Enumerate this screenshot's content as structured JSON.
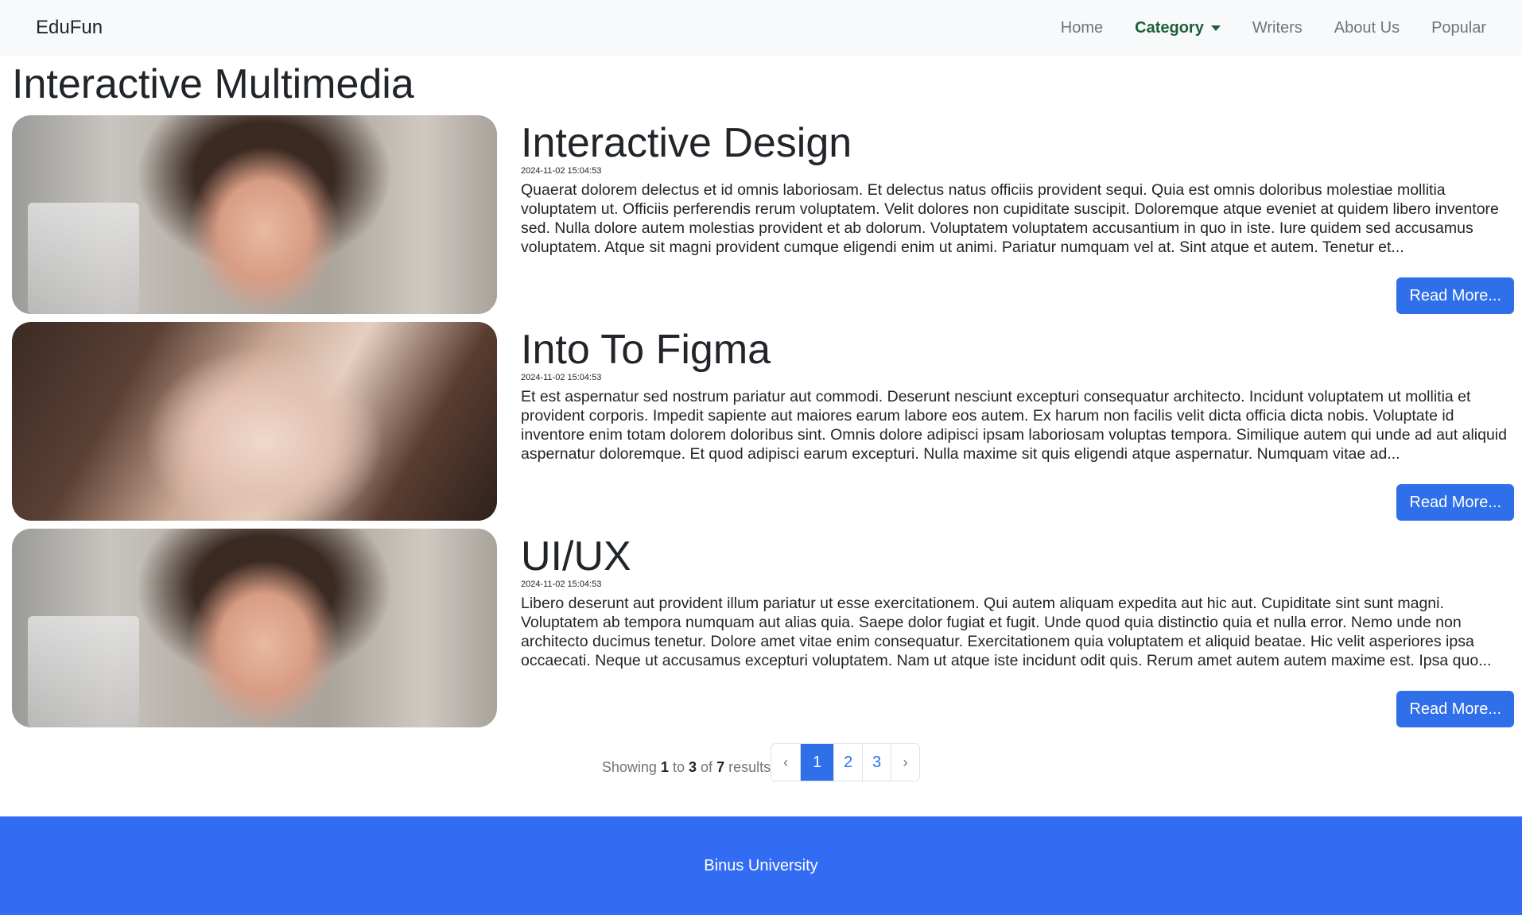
{
  "navbar": {
    "brand": "EduFun",
    "links": {
      "home": "Home",
      "category": "Category",
      "writers": "Writers",
      "about": "About Us",
      "popular": "Popular"
    }
  },
  "page": {
    "title": "Interactive Multimedia"
  },
  "articles": [
    {
      "title": "Interactive Design",
      "date": "2024-11-02 15:04:53",
      "excerpt": "Quaerat dolorem delectus et id omnis laboriosam. Et delectus natus officiis provident sequi. Quia est omnis doloribus molestiae mollitia voluptatem ut. Officiis perferendis rerum voluptatem. Velit dolores non cupiditate suscipit. Doloremque atque eveniet at quidem libero inventore sed. Nulla dolore autem molestias provident et ab dolorum. Voluptatem voluptatem accusantium in quo in iste. Iure quidem sed accusamus voluptatem. Atque sit magni provident cumque eligendi enim ut animi. Pariatur numquam vel at. Sint atque et autem. Tenetur et...",
      "button": "Read More..."
    },
    {
      "title": "Into To Figma",
      "date": "2024-11-02 15:04:53",
      "excerpt": "Et est aspernatur sed nostrum pariatur aut commodi. Deserunt nesciunt excepturi consequatur architecto. Incidunt voluptatem ut mollitia et provident corporis. Impedit sapiente aut maiores earum labore eos autem. Ex harum non facilis velit dicta officia dicta nobis. Voluptate id inventore enim totam dolorem doloribus sint. Omnis dolore adipisci ipsam laboriosam voluptas tempora. Similique autem qui unde ad aut aliquid aspernatur doloremque. Et quod adipisci earum excepturi. Nulla maxime sit quis eligendi atque aspernatur. Numquam vitae ad...",
      "button": "Read More..."
    },
    {
      "title": "UI/UX",
      "date": "2024-11-02 15:04:53",
      "excerpt": "Libero deserunt aut provident illum pariatur ut esse exercitationem. Qui autem aliquam expedita aut hic aut. Cupiditate sint sunt magni. Voluptatem ab tempora numquam aut alias quia. Saepe dolor fugiat et fugit. Unde quod quia distinctio quia et nulla error. Nemo unde non architecto ducimus tenetur. Dolore amet vitae enim consequatur. Exercitationem quia voluptatem et aliquid beatae. Hic velit asperiores ipsa occaecati. Neque ut accusamus excepturi voluptatem. Nam ut atque iste incidunt odit quis. Rerum amet autem autem maxime est. Ipsa quo...",
      "button": "Read More..."
    }
  ],
  "pagination": {
    "showing_prefix": "Showing",
    "from": "1",
    "to_word": "to",
    "to": "3",
    "of_word": "of",
    "total": "7",
    "results_word": "results",
    "prev": "‹",
    "pages": [
      "1",
      "2",
      "3"
    ],
    "next": "›",
    "current_page": "1"
  },
  "footer": {
    "text": "Binus University"
  },
  "colors": {
    "accent": "#2f6fea",
    "footer": "#326cf3",
    "navbar_bg": "#f8f9fa",
    "active_nav": "#1e5e3b"
  }
}
